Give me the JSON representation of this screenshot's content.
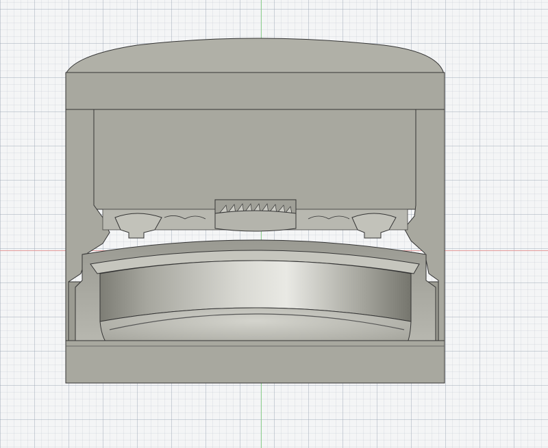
{
  "viewport": {
    "background": "#f4f5f6",
    "grid_color": "#a9b2bf",
    "axes": {
      "x_axis_color": "#e49a9a",
      "y_axis_color": "#8fd08f"
    }
  },
  "model": {
    "body_color": "#a8a89f",
    "shade_color": "#8f8f86",
    "highlight_color": "#cfcfc8",
    "edge_color": "#333333",
    "view": "section-view"
  }
}
